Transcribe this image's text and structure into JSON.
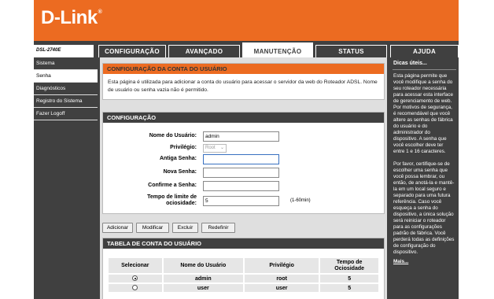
{
  "brand": {
    "logo_text": "D-Link",
    "reg_mark": "®"
  },
  "model": "DSL-2740E",
  "tabs": [
    {
      "label": "CONFIGURAÇÃO"
    },
    {
      "label": "AVANÇADO"
    },
    {
      "label": "MANUTENÇÃO",
      "active": true
    },
    {
      "label": "STATUS"
    },
    {
      "label": "AJUDA"
    }
  ],
  "sidebar": {
    "items": [
      {
        "label": "Sistema"
      },
      {
        "label": "Senha",
        "active": true
      },
      {
        "label": "Diagnósticos"
      },
      {
        "label": "Registro do Sistema"
      },
      {
        "label": "Fazer Logoff"
      }
    ]
  },
  "intro": {
    "title": "CONFIGURAÇÃO DA CONTA DO USUÁRIO",
    "text": "Esta página é utilizada para adicionar a conta do usuário para acessar o servidor da web do Roteador ADSL. Nome de usuário ou senha vazia não é permitido."
  },
  "config": {
    "title": "CONFIGURAÇÃO",
    "username_label": "Nome do Usuário:",
    "username_value": "admin",
    "privilege_label": "Privilégio:",
    "privilege_value": "Root",
    "old_password_label": "Antiga Senha:",
    "new_password_label": "Nova Senha:",
    "confirm_label": "Confirme a Senha:",
    "timeout_label_1": "Tempo de limite de",
    "timeout_label_2": "ociosidade:",
    "timeout_value": "5",
    "timeout_unit": "(1-60min)"
  },
  "buttons": {
    "add": "Adicionar",
    "modify": "Modificar",
    "delete": "Excluir",
    "reset": "Redefinir"
  },
  "account_table": {
    "title": "TABELA DE CONTA DO USUÁRIO",
    "columns": [
      "Selecionar",
      "Nome do Usuário",
      "Privilégio",
      "Tempo de Ociosidade"
    ],
    "rows": [
      {
        "selected": true,
        "user": "admin",
        "privilege": "root",
        "idle": "5"
      },
      {
        "selected": false,
        "user": "user",
        "privilege": "user",
        "idle": "5"
      }
    ]
  },
  "help": {
    "title": "Dicas úteis...",
    "p1": "Esta página permite que você modifique a senha do seu roteador necessária para acessar esta interface de gerenciamento de web. Por motivos de segurança, é recomendável que você altere as senhas de fábrica do usuário e do administrador do dispositivo. A senha que você escolher deve ter entre 1 e 16 caracteres.",
    "p2": "Por favor, certifique-se de escolher uma senha que você possa lembrar, ou então, de anotá-la e mantê-la em um local seguro e separado para uma futura referência. Caso você esqueça a senha do dispositivo, a única solução será reiniciar o roteador para as configurações padrão de fábrica. Você perderá todas as definições de configuração do dispositivo.",
    "more": "Mais..."
  }
}
